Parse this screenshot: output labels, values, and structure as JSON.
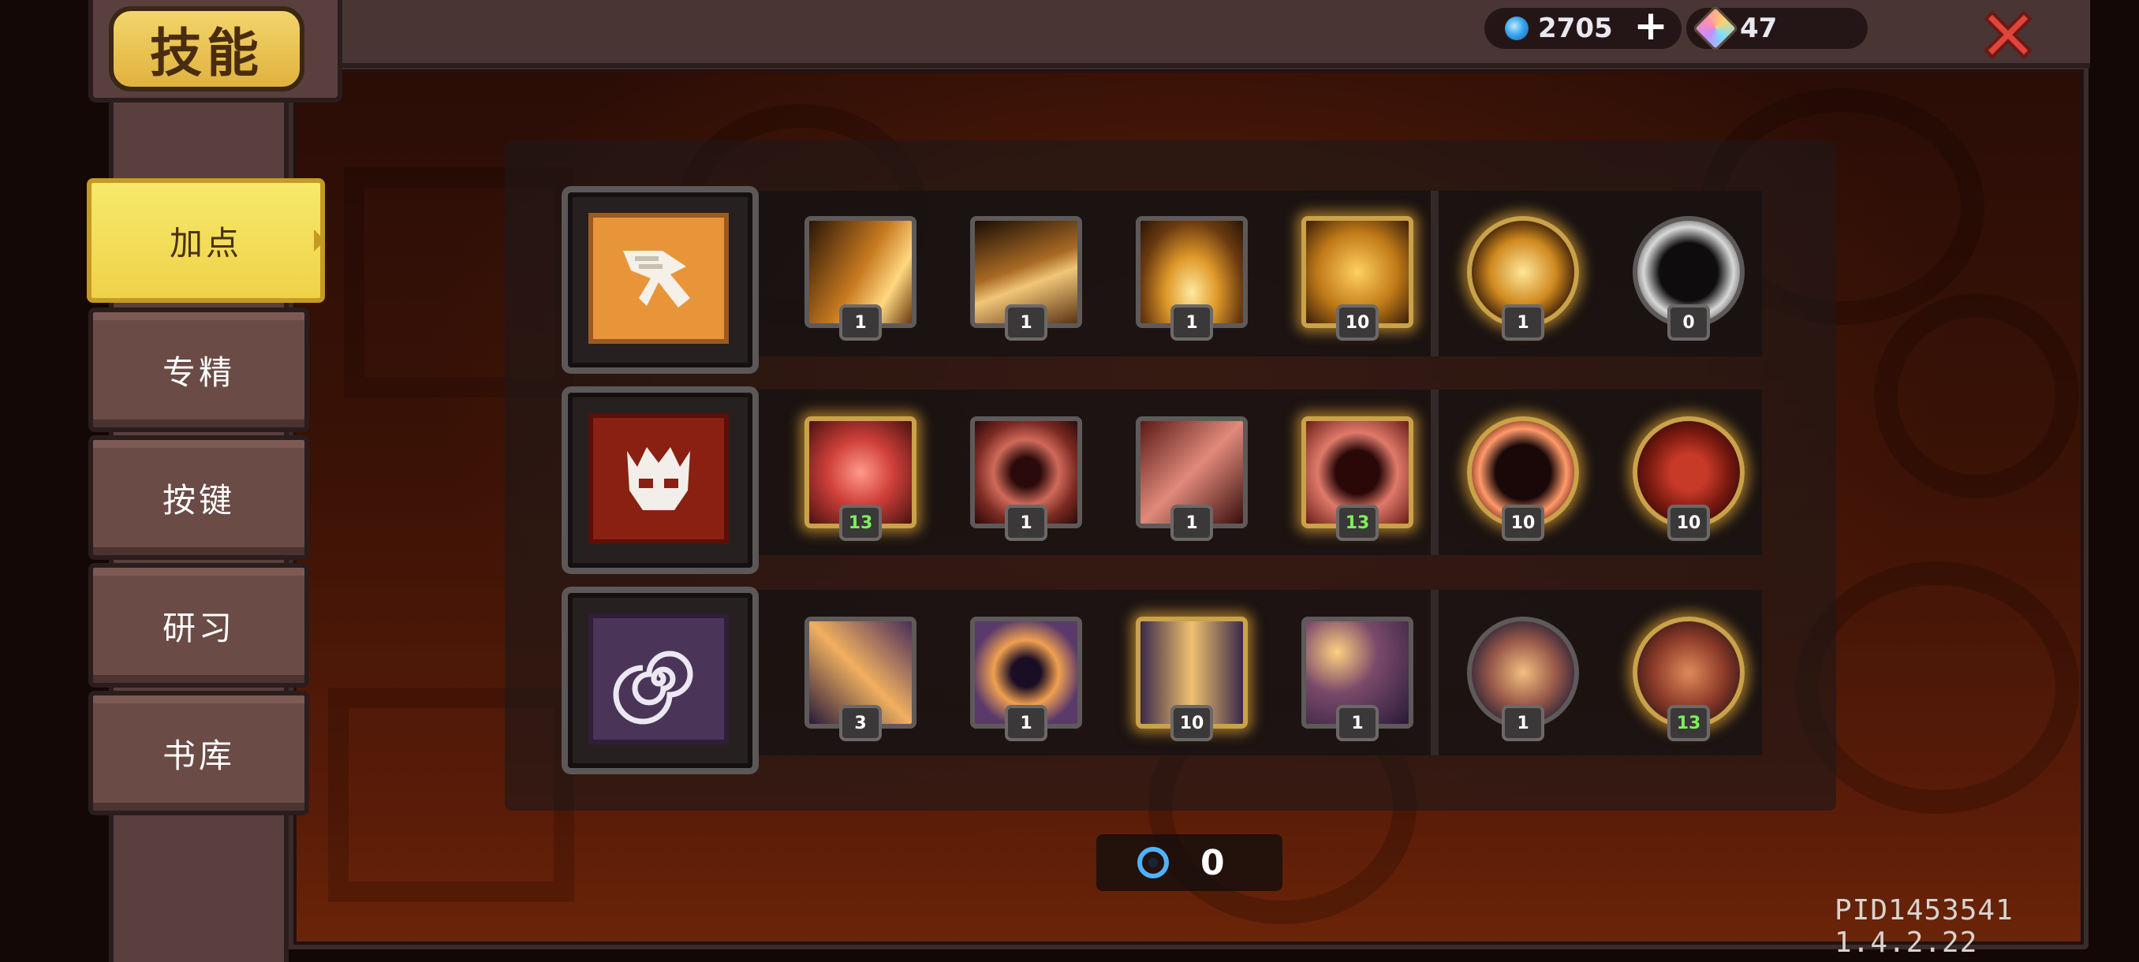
{
  "header": {
    "title": "技能",
    "currency_gems": "2705",
    "currency_crystals": "47",
    "plus_label": "+"
  },
  "sidebar": {
    "tabs": [
      {
        "label": "加点",
        "active": true
      },
      {
        "label": "专精",
        "active": false
      },
      {
        "label": "按键",
        "active": false
      },
      {
        "label": "研习",
        "active": false
      },
      {
        "label": "书库",
        "active": false
      }
    ]
  },
  "skill_rows": [
    {
      "category": "wings",
      "skills": [
        {
          "icon": "crescent-slash-icon",
          "level": "1"
        },
        {
          "icon": "whirlwind-icon",
          "level": "1"
        },
        {
          "icon": "sword-ring-icon",
          "level": "1"
        },
        {
          "icon": "golden-rage-icon",
          "level": "10"
        },
        {
          "icon": "golden-sword-passive-icon",
          "level": "1"
        },
        {
          "icon": "dark-orb-passive-icon",
          "level": "0"
        }
      ]
    },
    {
      "category": "demon",
      "skills": [
        {
          "icon": "blood-axe-icon",
          "level": "13"
        },
        {
          "icon": "blood-burst-icon",
          "level": "1"
        },
        {
          "icon": "blood-spear-icon",
          "level": "1"
        },
        {
          "icon": "blood-skull-icon",
          "level": "13"
        },
        {
          "icon": "dark-skull-passive-icon",
          "level": "10"
        },
        {
          "icon": "blood-bell-passive-icon",
          "level": "10"
        }
      ]
    },
    {
      "category": "spiral",
      "skills": [
        {
          "icon": "star-comet-icon",
          "level": "3"
        },
        {
          "icon": "vortex-icon",
          "level": "1"
        },
        {
          "icon": "light-pillar-icon",
          "level": "10"
        },
        {
          "icon": "orbiting-orbs-icon",
          "level": "1"
        },
        {
          "icon": "chain-seal-passive-icon",
          "level": "1"
        },
        {
          "icon": "octopus-passive-icon",
          "level": "13"
        }
      ]
    }
  ],
  "points": {
    "value": "0"
  },
  "footer": {
    "pid": "PID1453541 1.4.2.22"
  },
  "colors": {
    "accent_gold": "#efd24a",
    "panel_brown": "#5a3f3f",
    "level_green": "#7cf05a",
    "close_red": "#e0443a"
  }
}
